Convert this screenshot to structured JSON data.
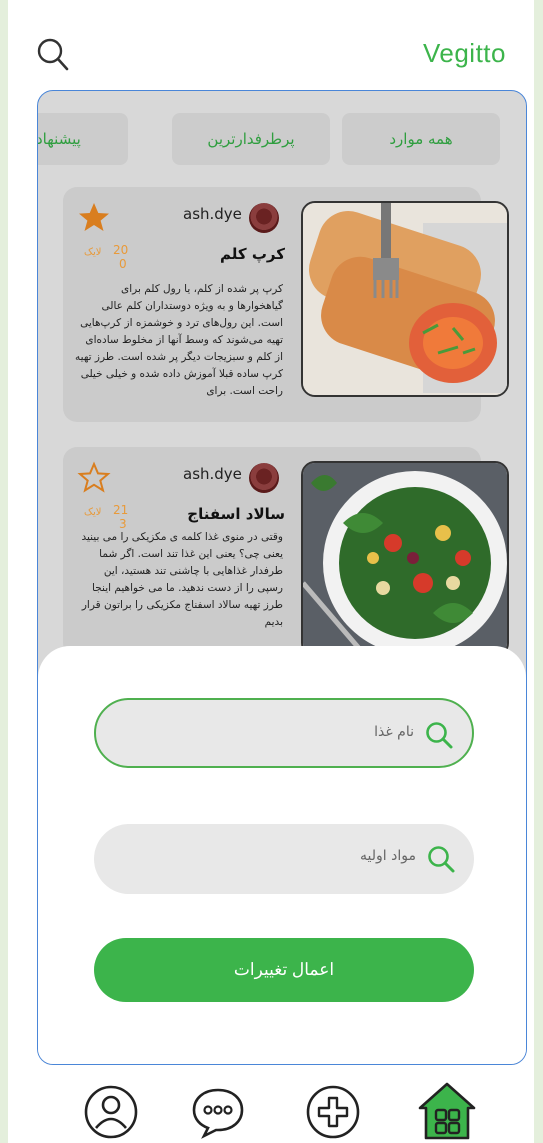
{
  "app": {
    "brand": "Vegitto"
  },
  "tabs": [
    {
      "label": "همه موارد"
    },
    {
      "label": "پرطرفدارترین"
    },
    {
      "label": "پیشنهاد"
    }
  ],
  "recipes": [
    {
      "author": "ash.dye",
      "title": "کرپ کلم",
      "likes_count": "20",
      "likes_label": "لایک",
      "comments_count": "0",
      "favorite": true,
      "description": "کرپ پر شده از کلم، یا رول کلم برای گیاهخوارها و به ویژه دوستداران کلم عالی است. این رول‌های ترد و خوشمزه از کرپ‌هایی تهیه می‌شوند که وسط آنها از مخلوط ساده‌ای از کلم و سبزیجات دیگر پر شده است. طرز تهیه کرپ ساده قبلا آموزش داده شده و خیلی خیلی راحت است. برای"
    },
    {
      "author": "ash.dye",
      "title": "سالاد اسفناج",
      "likes_count": "21",
      "likes_label": "لایک",
      "comments_count": "3",
      "favorite": false,
      "description": "وقتی در منوی غذا کلمه ی مکزیکی را می بینید یعنی چی؟ یعنی این غذا تند است. اگر شما طرفدار غذاهایی با چاشنی تند هستید، این رسپی را از دست ندهید. ما می خواهیم اینجا طرز تهیه سالاد اسفناج مکزیکی را براتون قرار بدیم"
    }
  ],
  "search_sheet": {
    "food_name_placeholder": "نام غذا",
    "ingredients_placeholder": "مواد اولیه",
    "apply_label": "اعمال تغییرات"
  },
  "icons": {
    "top_search": "search-icon",
    "profile": "user-icon",
    "chat": "chat-bubble-icon",
    "add": "plus-circle-icon",
    "home": "home-icon"
  },
  "colors": {
    "accent": "#3cb44b",
    "like": "#e89a3a",
    "frame_border": "#4a86d8"
  }
}
